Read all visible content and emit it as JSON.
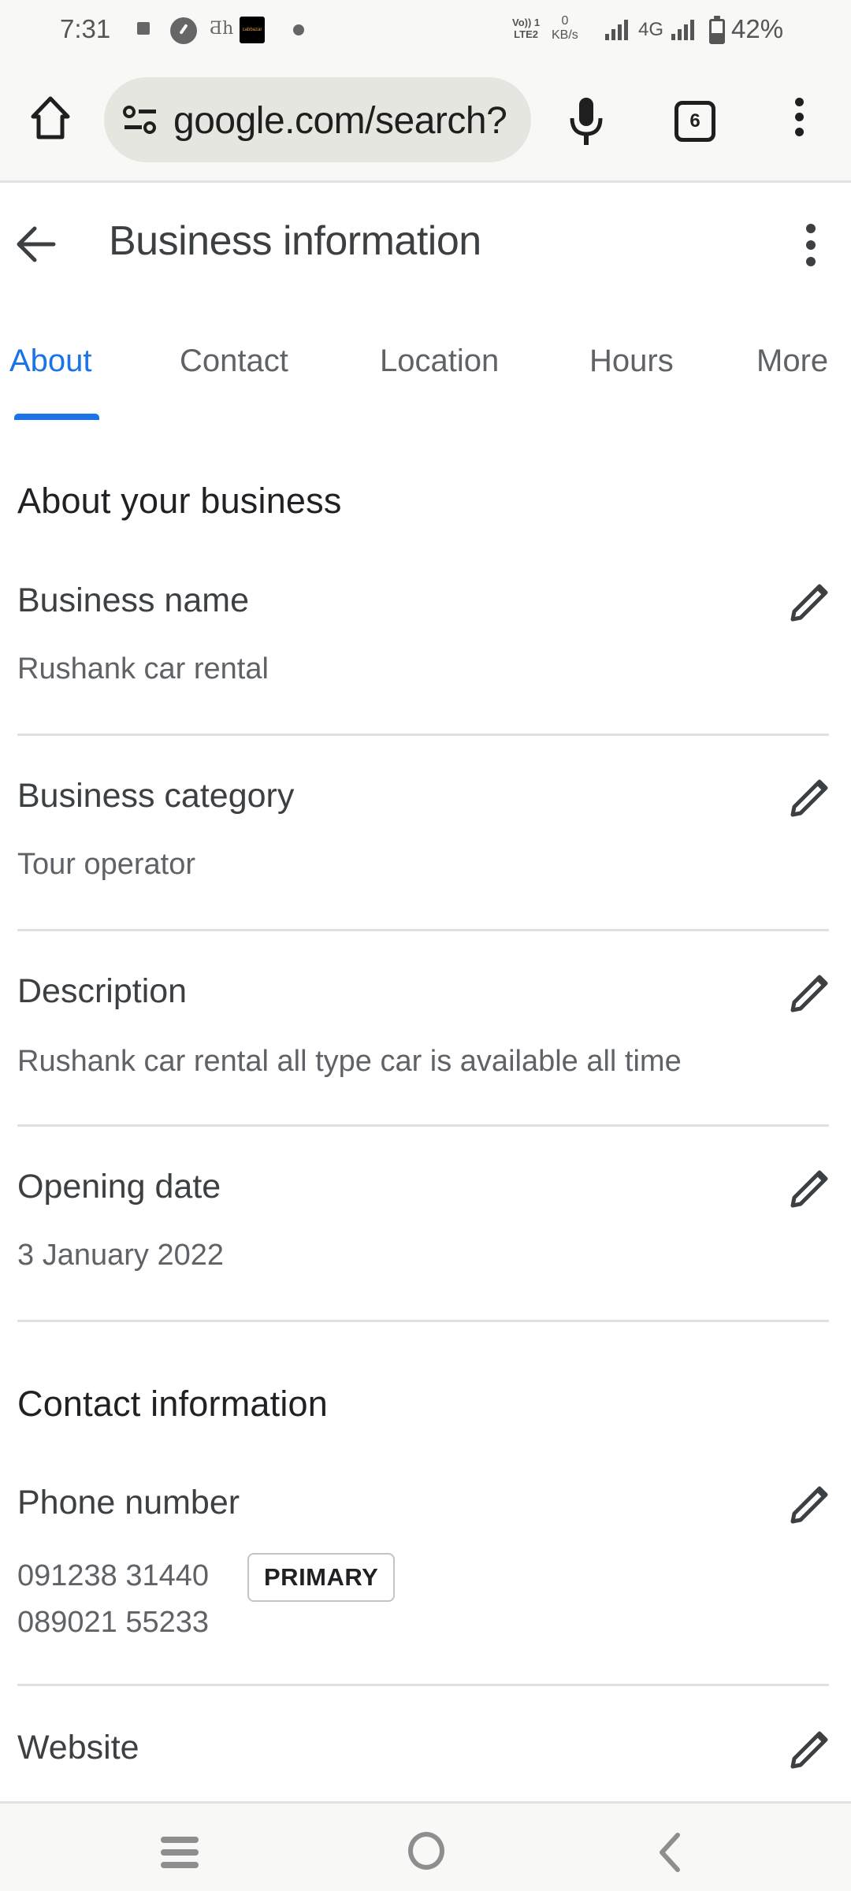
{
  "status_bar": {
    "time": "7:31",
    "volte_top": "Vo)) 1",
    "volte_bottom": "LTE2",
    "speed_value": "0",
    "speed_unit": "KB/s",
    "network_type": "4G",
    "battery_percent": "42%",
    "battery_level": 0.42,
    "cab_app_label": "cabbazar"
  },
  "browser": {
    "url": "google.com/search?",
    "tab_count": "6"
  },
  "header": {
    "title": "Business information"
  },
  "tabs": [
    {
      "label": "About",
      "active": true
    },
    {
      "label": "Contact",
      "active": false
    },
    {
      "label": "Location",
      "active": false
    },
    {
      "label": "Hours",
      "active": false
    },
    {
      "label": "More",
      "active": false
    }
  ],
  "about_section": {
    "heading": "About your business",
    "fields": [
      {
        "label": "Business name",
        "value": "Rushank car rental"
      },
      {
        "label": "Business category",
        "value": "Tour operator"
      },
      {
        "label": "Description",
        "value": "Rushank car rental all type car is available all time"
      },
      {
        "label": "Opening date",
        "value": "3 January 2022"
      }
    ]
  },
  "contact_section": {
    "heading": "Contact information",
    "phone": {
      "label": "Phone number",
      "numbers": [
        "091238 31440",
        "089021 55233"
      ],
      "primary_badge": "PRIMARY"
    },
    "website": {
      "label": "Website"
    }
  },
  "colors": {
    "accent": "#1a73e8",
    "text_primary": "#202124",
    "text_secondary": "#5f6368",
    "divider": "#e0e0e0",
    "omnibox_bg": "#e4e6df"
  }
}
